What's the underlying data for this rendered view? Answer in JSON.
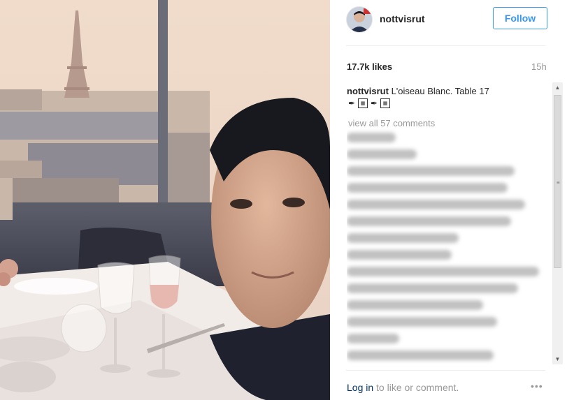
{
  "post": {
    "username": "nottvisrut",
    "follow_label": "Follow",
    "likes": "17.7k likes",
    "age": "15h",
    "caption_user": "nottvisrut",
    "caption_text": " L'oiseau Blanc. Table 17",
    "view_all": "view all 57 comments",
    "login_link": "Log in",
    "login_text": " to like or comment.",
    "more_options": "•••"
  },
  "icons": {
    "avatar": "avatar-icon",
    "more": "more-options-icon"
  },
  "colors": {
    "accent": "#3897f0",
    "link": "#003569",
    "muted": "#999999"
  }
}
